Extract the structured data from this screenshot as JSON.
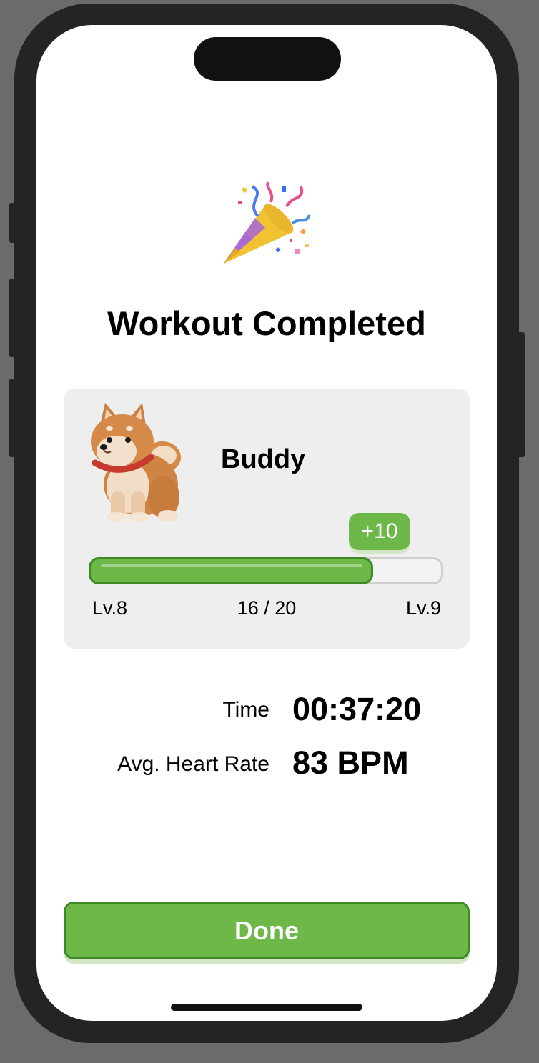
{
  "screen": {
    "title": "Workout Completed"
  },
  "pet": {
    "name": "Buddy",
    "xp_gain": "+10",
    "current_level": "Lv.8",
    "next_level": "Lv.9",
    "progress_text": "16 / 20",
    "progress_fraction": 0.8
  },
  "stats": [
    {
      "label": "Time",
      "value": "00:37:20"
    },
    {
      "label": "Avg. Heart Rate",
      "value": "83 BPM"
    }
  ],
  "actions": {
    "done_label": "Done"
  },
  "icons": {
    "celebration": "party-popper-icon",
    "pet_avatar": "shiba-dog-icon"
  },
  "colors": {
    "accent": "#6db849",
    "accent_border": "#3f8a25",
    "card_bg": "#eeeeee"
  }
}
